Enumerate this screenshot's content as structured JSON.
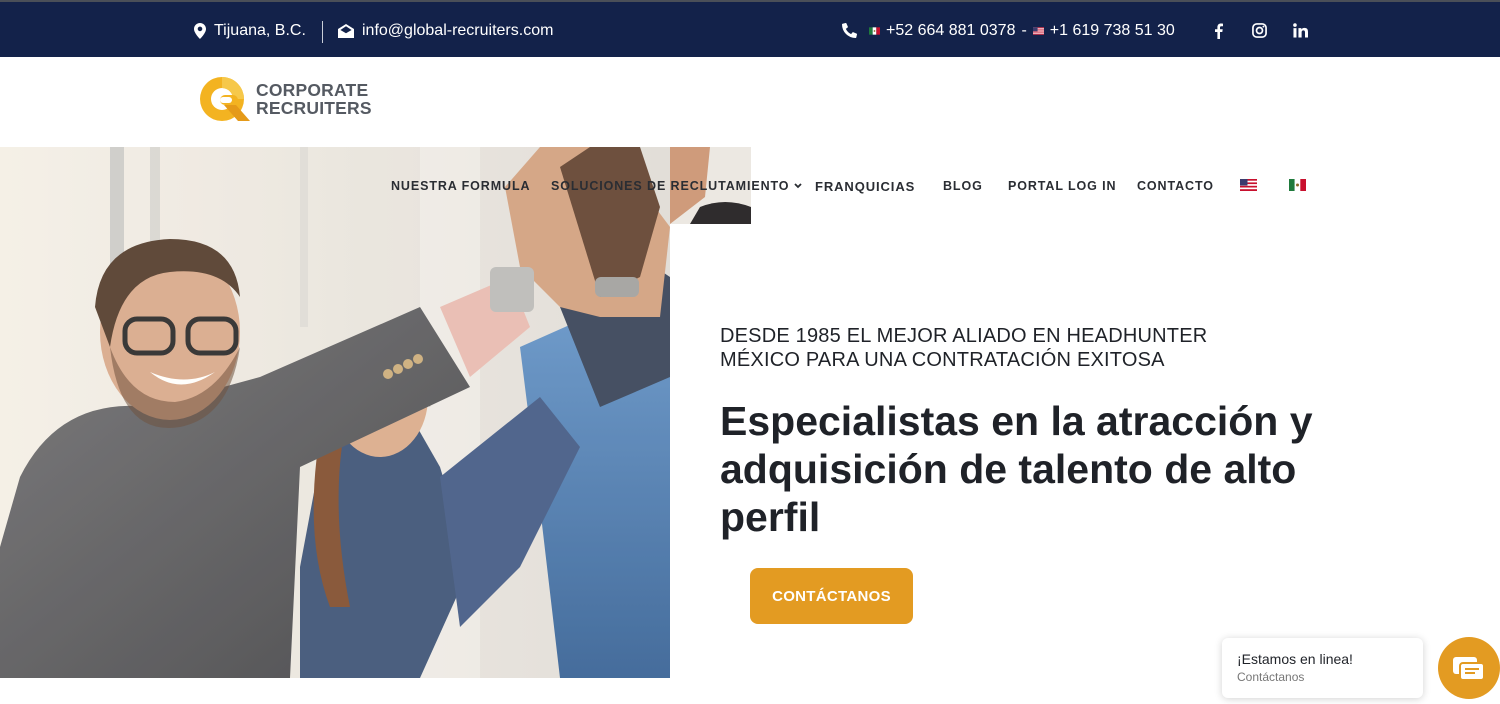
{
  "topbar": {
    "location": "Tijuana, B.C.",
    "email": "info@global-recruiters.com",
    "phone_mx": "+52 664 881 0378",
    "phone_sep": "-",
    "phone_us": "+1 619 738 51 30",
    "icons": [
      "map-pin-icon",
      "envelope-icon",
      "phone-icon",
      "facebook-icon",
      "instagram-icon",
      "linkedin-icon"
    ]
  },
  "logo": {
    "line1": "CORPORATE",
    "line2": "RECRUITERS"
  },
  "nav": {
    "items": [
      "NUESTRA FORMULA",
      "SOLUCIONES DE RECLUTAMIENTO",
      "FRANQUICIAS",
      "BLOG",
      "PORTAL LOG IN",
      "CONTACTO"
    ],
    "languages": [
      "us-flag-icon",
      "mx-flag-icon"
    ]
  },
  "hero": {
    "eyebrow": "DESDE 1985 EL MEJOR ALIADO EN HEADHUNTER MÉXICO PARA UNA CONTRATACIÓN EXITOSA",
    "headline": "Especialistas en la atracción y adquisición de talento de alto perfil",
    "cta": "CONTÁCTANOS"
  },
  "chat": {
    "title": "¡Estamos en linea!",
    "subtitle": "Contáctanos"
  },
  "colors": {
    "topbar": "#13224a",
    "accent": "#e39b22",
    "text": "#1f2228"
  }
}
